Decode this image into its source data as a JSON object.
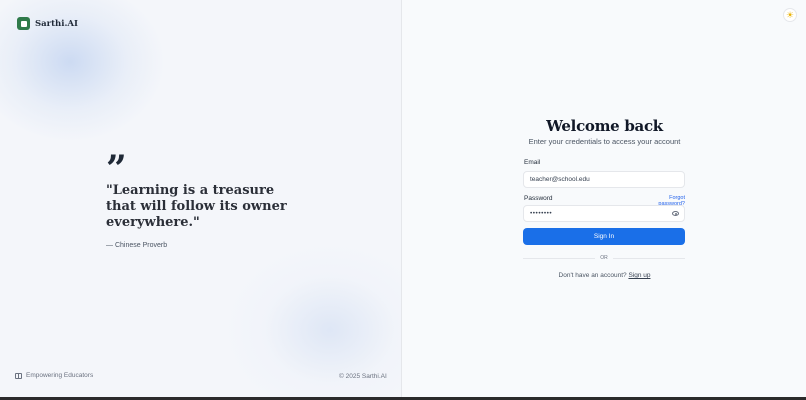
{
  "brand": {
    "name": "Sarthi.AI",
    "logo": "sarthi-logo-icon"
  },
  "quote": {
    "mark": "”",
    "text": "\"Learning is a treasure that will follow its owner everywhere.\"",
    "author": "— Chinese Proverb"
  },
  "footer": {
    "tagline": "Empowering Educators",
    "tagline_icon": "book-open-icon",
    "copyright": "© 2025 Sarthi.AI"
  },
  "theme_toggle": {
    "icon": "sun-icon",
    "glyph": "☀"
  },
  "login": {
    "title": "Welcome back",
    "subtitle": "Enter your credentials to access your account",
    "email_label": "Email",
    "email_value": "teacher@school.edu",
    "password_label": "Password",
    "forgot_label": "Forgot password?",
    "password_value": "••••••••",
    "password_icon": "eye-icon",
    "signin_label": "Sign In",
    "or_label": "OR",
    "no_account_text": "Don't have an account?",
    "signup_label": "Sign up"
  },
  "colors": {
    "primary": "#1a6fe8",
    "brand_green": "#2f7a4a",
    "sun": "#eab308"
  }
}
